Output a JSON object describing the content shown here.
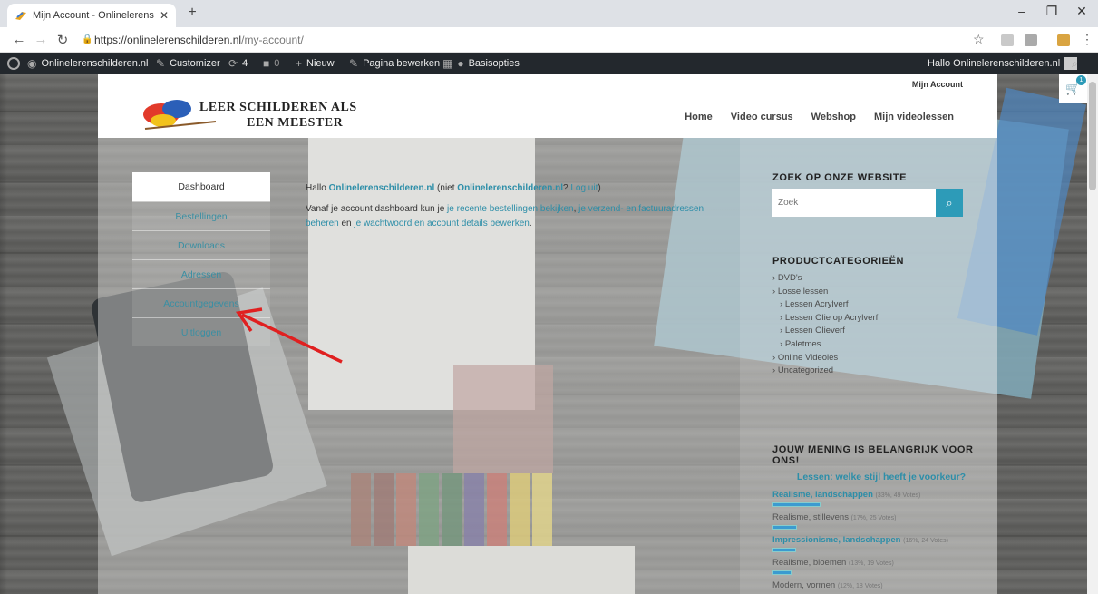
{
  "browser": {
    "tab_title": "Mijn Account - Onlinelerenschild",
    "url_host": "https://onlinelerenschilderen.nl",
    "url_path": "/my-account/"
  },
  "adminbar": {
    "site_name": "Onlinelerenschilderen.nl",
    "customizer": "Customizer",
    "updates_count": "4",
    "comments_count": "0",
    "new_label": "Nieuw",
    "edit_page": "Pagina bewerken",
    "basic_options": "Basisopties",
    "greeting": "Hallo Onlinelerenschilderen.nl"
  },
  "site": {
    "account_link": "Mijn Account",
    "logo_line1": "Leer Schilderen als",
    "logo_line2": "een Meester",
    "nav": [
      "Home",
      "Video cursus",
      "Webshop",
      "Mijn videolessen"
    ],
    "cart_count": "1"
  },
  "account_nav": [
    {
      "label": "Dashboard",
      "active": true
    },
    {
      "label": "Bestellingen",
      "active": false
    },
    {
      "label": "Downloads",
      "active": false
    },
    {
      "label": "Adressen",
      "active": false
    },
    {
      "label": "Accountgegevens",
      "active": false
    },
    {
      "label": "Uitloggen",
      "active": false
    }
  ],
  "dashboard": {
    "hello_prefix": "Hallo ",
    "hello_user": "Onlinelerenschilderen.nl",
    "hello_mid": " (niet ",
    "hello_user2": "Onlinelerenschilderen.nl",
    "hello_q": "? ",
    "logout_link": "Log uit",
    "hello_end": ")",
    "intro_prefix": "Vanaf je account dashboard kun je ",
    "intro_link1": "je recente bestellingen bekijken",
    "intro_mid1": ", ",
    "intro_link2": "je verzend- en factuuradressen beheren",
    "intro_mid2": " en ",
    "intro_link3": "je wachtwoord en account details bewerken",
    "intro_end": "."
  },
  "widgets": {
    "search_title": "ZOEK OP ONZE WEBSITE",
    "search_placeholder": "Zoek",
    "categories_title": "PRODUCTCATEGORIEËN",
    "categories": [
      {
        "label": "DVD's",
        "sub": false
      },
      {
        "label": "Losse lessen",
        "sub": false
      },
      {
        "label": "Lessen Acrylverf",
        "sub": true
      },
      {
        "label": "Lessen Olie op Acrylverf",
        "sub": true
      },
      {
        "label": "Lessen Olieverf",
        "sub": true
      },
      {
        "label": "Paletmes",
        "sub": true
      },
      {
        "label": "Online Videoles",
        "sub": false
      },
      {
        "label": "Uncategorized",
        "sub": false
      }
    ],
    "poll_title": "JOUW MENING IS BELANGRIJK VOOR ONS!",
    "poll_question": "Lessen: welke stijl heeft je voorkeur?",
    "poll_answers": [
      {
        "label": "Realisme, landschappen",
        "meta": "(33%, 49 Votes)",
        "pct": 33,
        "highlight": true
      },
      {
        "label": "Realisme, stillevens",
        "meta": "(17%, 25 Votes)",
        "pct": 17,
        "highlight": false
      },
      {
        "label": "Impressionisme, landschappen",
        "meta": "(16%, 24 Votes)",
        "pct": 16,
        "highlight": true
      },
      {
        "label": "Realisme, bloemen",
        "meta": "(13%, 19 Votes)",
        "pct": 13,
        "highlight": false
      },
      {
        "label": "Modern, vormen",
        "meta": "(12%, 18 Votes)",
        "pct": 12,
        "highlight": false
      }
    ]
  },
  "colors": {
    "accent": "#2d9bb8",
    "link": "#2d8ea8",
    "annotation_arrow": "#e02020"
  }
}
